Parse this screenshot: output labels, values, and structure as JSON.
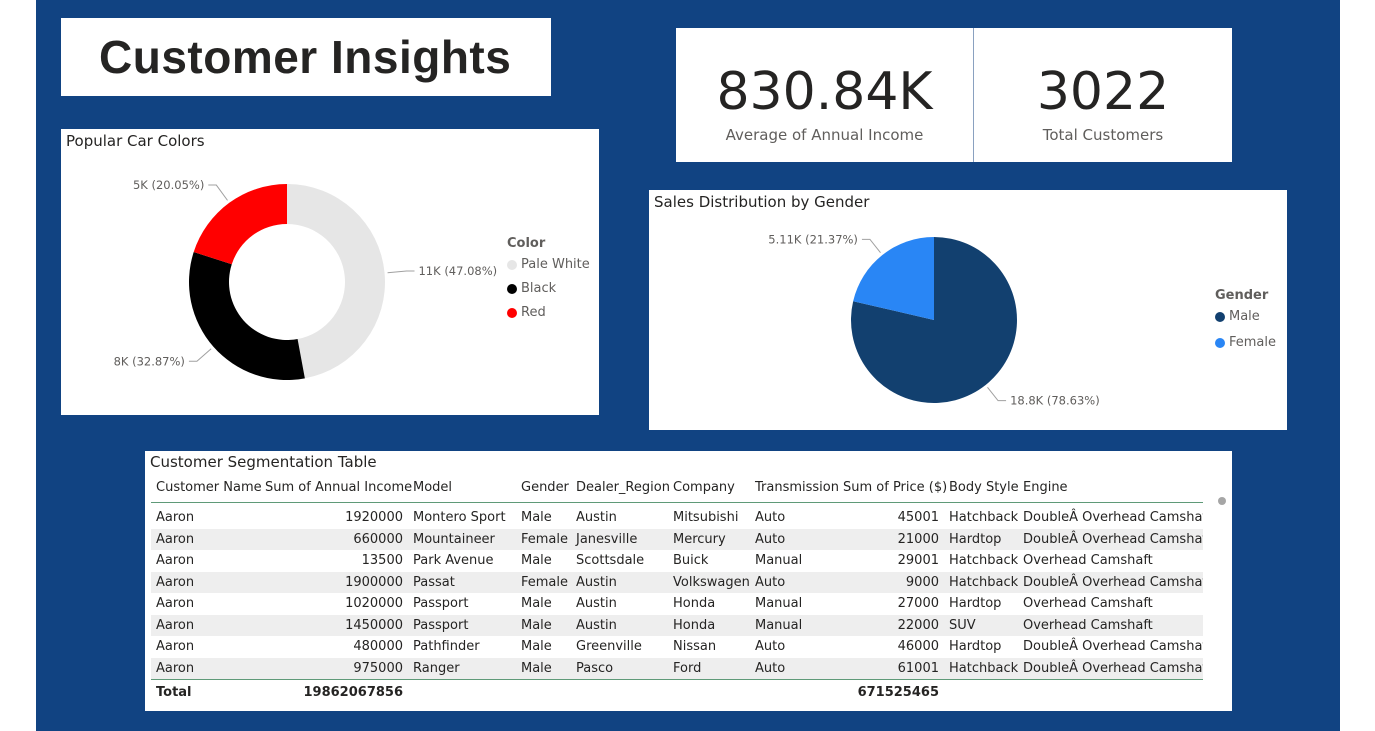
{
  "header": {
    "title": "Customer Insights"
  },
  "kpis": [
    {
      "value": "830.84K",
      "label": "Average of Annual Income"
    },
    {
      "value": "3022",
      "label": "Total Customers"
    }
  ],
  "donut": {
    "title": "Popular Car Colors",
    "legend_title": "Color",
    "slices": [
      {
        "name": "Pale White",
        "label": "11K (47.08%)",
        "percent": 47.08,
        "color": "#e6e6e6"
      },
      {
        "name": "Black",
        "label": "8K (32.87%)",
        "percent": 32.87,
        "color": "#000000"
      },
      {
        "name": "Red",
        "label": "5K (20.05%)",
        "percent": 20.05,
        "color": "#ff0000"
      }
    ]
  },
  "pie": {
    "title": "Sales Distribution by Gender",
    "legend_title": "Gender",
    "slices": [
      {
        "name": "Male",
        "label": "18.8K (78.63%)",
        "percent": 78.63,
        "color": "#12406f"
      },
      {
        "name": "Female",
        "label": "5.11K (21.37%)",
        "percent": 21.37,
        "color": "#2986f5"
      }
    ]
  },
  "table": {
    "title": "Customer Segmentation Table",
    "columns": [
      "Customer Name",
      "Sum of Annual Income",
      "Model",
      "Gender",
      "Dealer_Region",
      "Company",
      "Transmission",
      "Sum of Price ($)",
      "Body Style",
      "Engine"
    ],
    "rows": [
      [
        "Aaron",
        "1920000",
        "Montero Sport",
        "Male",
        "Austin",
        "Mitsubishi",
        "Auto",
        "45001",
        "Hatchback",
        "DoubleÂ Overhead Camshaft"
      ],
      [
        "Aaron",
        "660000",
        "Mountaineer",
        "Female",
        "Janesville",
        "Mercury",
        "Auto",
        "21000",
        "Hardtop",
        "DoubleÂ Overhead Camshaft"
      ],
      [
        "Aaron",
        "13500",
        "Park Avenue",
        "Male",
        "Scottsdale",
        "Buick",
        "Manual",
        "29001",
        "Hatchback",
        "Overhead Camshaft"
      ],
      [
        "Aaron",
        "1900000",
        "Passat",
        "Female",
        "Austin",
        "Volkswagen",
        "Auto",
        "9000",
        "Hatchback",
        "DoubleÂ Overhead Camshaft"
      ],
      [
        "Aaron",
        "1020000",
        "Passport",
        "Male",
        "Austin",
        "Honda",
        "Manual",
        "27000",
        "Hardtop",
        "Overhead Camshaft"
      ],
      [
        "Aaron",
        "1450000",
        "Passport",
        "Male",
        "Austin",
        "Honda",
        "Manual",
        "22000",
        "SUV",
        "Overhead Camshaft"
      ],
      [
        "Aaron",
        "480000",
        "Pathfinder",
        "Male",
        "Greenville",
        "Nissan",
        "Auto",
        "46000",
        "Hardtop",
        "DoubleÂ Overhead Camshaft"
      ],
      [
        "Aaron",
        "975000",
        "Ranger",
        "Male",
        "Pasco",
        "Ford",
        "Auto",
        "61001",
        "Hatchback",
        "DoubleÂ Overhead Camshaft"
      ]
    ],
    "total": {
      "label": "Total",
      "income": "19862067856",
      "price": "671525465"
    }
  }
}
